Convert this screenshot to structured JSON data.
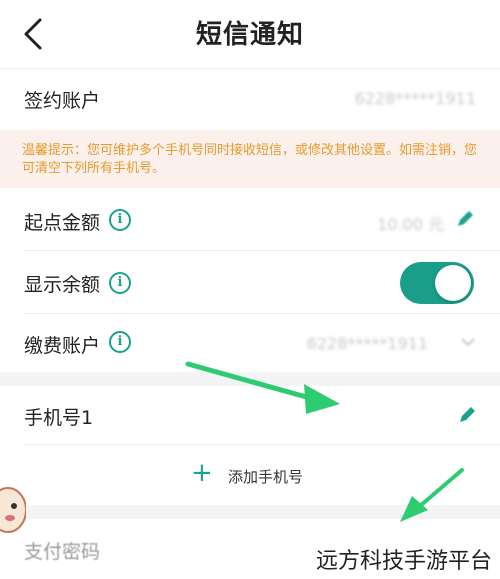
{
  "header": {
    "title": "短信通知",
    "back_icon": "chevron-left-icon"
  },
  "account": {
    "label": "签约账户",
    "value": "6228*****1911"
  },
  "notice": {
    "text": "温馨提示：您可维护多个手机号同时接收短信，或修改其他设置。如需注销，您可清空下列所有手机号。"
  },
  "start_amount": {
    "label": "起点金额",
    "value": "10.00 元"
  },
  "show_balance": {
    "label": "显示余额",
    "enabled": true
  },
  "pay_account": {
    "label": "缴费账户",
    "value": "6228*****1911"
  },
  "phone": {
    "label": "手机号1"
  },
  "add_phone": {
    "label": "添加手机号"
  },
  "pay_password": {
    "label": "支付密码"
  },
  "watermark": {
    "text": "远方科技手游平台"
  },
  "colors": {
    "accent": "#1aa38c",
    "notice_text": "#e89a2c",
    "notice_bg": "#fbf0ec",
    "arrow": "#2ecc71"
  }
}
